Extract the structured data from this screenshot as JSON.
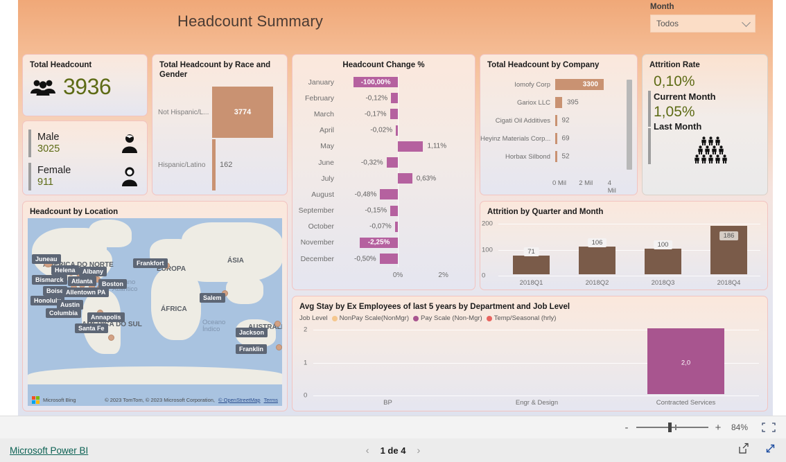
{
  "report": {
    "title": "Headcount Summary",
    "slicer": {
      "label": "Month",
      "value": "Todos"
    }
  },
  "total_headcount": {
    "title": "Total Headcount",
    "value": "3936"
  },
  "gender": {
    "rows": [
      {
        "label": "Male",
        "value": "3025"
      },
      {
        "label": "Female",
        "value": "911"
      }
    ]
  },
  "attrition_rate": {
    "title": "Attrition Rate",
    "current_value": "0,10%",
    "current_label": "Current Month",
    "last_value": "1,05%",
    "last_label": "Last Month"
  },
  "map": {
    "title": "Headcount by Location",
    "labels": [
      "Juneau",
      "Helena",
      "Albany",
      "Bismarck",
      "Atlanta",
      "Boston",
      "Boise",
      "Allentown PA",
      "Honolulu",
      "Austin",
      "Columbia",
      "Annapolis",
      "Santa Fe",
      "Frankfort",
      "Salem",
      "Jackson",
      "Franklin"
    ],
    "continents": [
      "AMÉRICA DO NORTE",
      "AMÉRICA DO SUL",
      "EUROPA",
      "ÁFRICA",
      "ÁSIA",
      "AUSTRÁLIA"
    ],
    "oceans": [
      "Oceano Atlântico",
      "Oceano Índico"
    ],
    "attribution": {
      "brand": "Microsoft Bing",
      "copyright": "© 2023 TomTom, © 2023 Microsoft Corporation,",
      "osm": "© OpenStreetMap",
      "terms": "Terms"
    }
  },
  "chart_data": [
    {
      "type": "bar",
      "id": "race_gender",
      "title": "Total Headcount by Race and Gender",
      "orientation": "horizontal",
      "categories": [
        "Not Hispanic/L...",
        "Hispanic/Latino"
      ],
      "values": [
        3774,
        162
      ],
      "labels": [
        "3774",
        "162"
      ],
      "color": "#c99272",
      "xlabel": "",
      "ylabel": "",
      "grid": false,
      "xlim": [
        0,
        3774
      ]
    },
    {
      "type": "bar",
      "id": "headcount_change",
      "title": "Headcount Change %",
      "orientation": "horizontal",
      "categories": [
        "January",
        "February",
        "March",
        "April",
        "May",
        "June",
        "July",
        "August",
        "September",
        "October",
        "November",
        "December"
      ],
      "values": [
        -100.0,
        -0.12,
        -0.17,
        -0.02,
        1.11,
        -0.32,
        0.63,
        -0.48,
        -0.15,
        -0.07,
        -2.25,
        -0.5
      ],
      "labels": [
        "-100,00%",
        "-0,12%",
        "-0,17%",
        "-0,02%",
        "1,11%",
        "-0,32%",
        "0,63%",
        "-0,48%",
        "-0,15%",
        "-0,07%",
        "-2,25%",
        "-0,50%"
      ],
      "color": "#b5619f",
      "xticks": [
        "0%",
        "2%"
      ],
      "xtick_values": [
        0,
        2
      ],
      "xlabel": "",
      "ylabel": "",
      "grid": true
    },
    {
      "type": "bar",
      "id": "headcount_company",
      "title": "Total Headcount by Company",
      "orientation": "horizontal",
      "categories": [
        "Iomofy Corp",
        "Gariox LLC",
        "Cigati Oil Additives",
        "Heyinz Materials Corp...",
        "Horbax Silbond"
      ],
      "values": [
        3300,
        395,
        92,
        69,
        52
      ],
      "labels": [
        "3300",
        "395",
        "92",
        "69",
        "52"
      ],
      "color": "#c99272",
      "xticks": [
        "0 Mil",
        "2 Mil",
        "4 Mil"
      ],
      "xtick_values": [
        0,
        2,
        4
      ],
      "xlabel": "",
      "ylabel": "",
      "grid": false
    },
    {
      "type": "bar",
      "id": "attrition_quarter",
      "title": "Attrition by Quarter and Month",
      "orientation": "vertical",
      "categories": [
        "2018Q1",
        "2018Q2",
        "2018Q3",
        "2018Q4"
      ],
      "values": [
        71,
        106,
        100,
        186
      ],
      "labels": [
        "71",
        "106",
        "100",
        "186"
      ],
      "color": "#7a5b49",
      "yticks": [
        "0",
        "100",
        "200"
      ],
      "ytick_values": [
        0,
        100,
        200
      ],
      "ylim": [
        0,
        200
      ],
      "xlabel": "",
      "ylabel": "",
      "grid": true
    },
    {
      "type": "bar",
      "id": "avg_stay",
      "title": "Avg Stay by Ex Employees of last 5 years by Department and Job Level",
      "orientation": "vertical",
      "legend_title": "Job Level",
      "legend": [
        {
          "name": "NonPay Scale(NonMgr)",
          "color": "#f5c78e"
        },
        {
          "name": "Pay Scale (Non-Mgr)",
          "color": "#a8558f"
        },
        {
          "name": "Temp/Seasonal (hrly)",
          "color": "#e8645f"
        }
      ],
      "categories": [
        "BP",
        "Engr & Design",
        "Contracted Services"
      ],
      "values": [
        0,
        0,
        2.0
      ],
      "labels": [
        "",
        "",
        "2,0"
      ],
      "yticks": [
        "0",
        "1",
        "2"
      ],
      "ytick_values": [
        0,
        1,
        2
      ],
      "ylim": [
        0,
        2
      ],
      "xlabel": "",
      "ylabel": "",
      "grid": true,
      "legend_position": "top"
    }
  ],
  "chrome": {
    "zoom_percent": "84%",
    "minus": "-",
    "plus": "+",
    "power_bi_link": "Microsoft Power BI",
    "page_indicator": "1 de 4",
    "prev_arrow": "‹",
    "next_arrow": "›"
  }
}
